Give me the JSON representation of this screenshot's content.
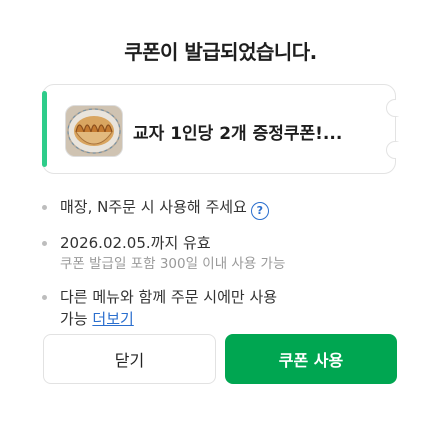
{
  "dialog": {
    "title": "쿠폰이 발급되었습니다.",
    "coupon": {
      "name": "교자 1인당 2개 증정쿠폰!...",
      "thumbnail_icon": "dumpling-image"
    },
    "notes": [
      {
        "text": "매장, N주문 시 사용해 주세요",
        "icon": "help-icon"
      },
      {
        "text": "2026.02.05.까지 유효",
        "sub": "쿠폰 발급일 포함 300일 이내 사용 가능"
      },
      {
        "text": "다른 메뉴와 함께 주문 시에만 사용",
        "text2": "가능",
        "link": "더보기"
      }
    ],
    "buttons": {
      "close_label": "닫기",
      "use_label": "쿠폰 사용"
    },
    "colors": {
      "accent": "#2ecc8a",
      "primary": "#00a651",
      "link": "#2b6fce"
    }
  }
}
